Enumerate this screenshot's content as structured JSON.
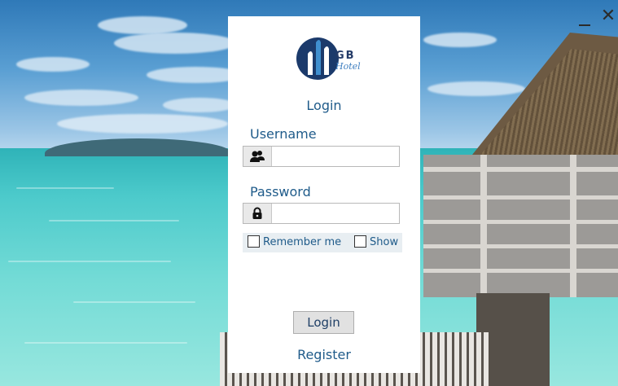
{
  "window": {
    "minimize_label": "–",
    "close_label": "✕"
  },
  "brand": {
    "logo_text": "GB",
    "logo_subtext": "Hotel",
    "logo_colors": {
      "primary": "#1b3a6b",
      "accent": "#3f8fcf"
    }
  },
  "form": {
    "title": "Login",
    "username": {
      "label": "Username",
      "value": "",
      "icon": "users-icon"
    },
    "password": {
      "label": "Password",
      "value": "",
      "icon": "lock-icon"
    },
    "remember_label": "Remember me",
    "show_label": "Show",
    "remember_checked": false,
    "show_checked": false,
    "login_button": "Login",
    "register_link": "Register"
  },
  "colors": {
    "text": "#1f5b8a",
    "panel_bg": "#ffffff",
    "button_bg": "#e1e1e1"
  }
}
